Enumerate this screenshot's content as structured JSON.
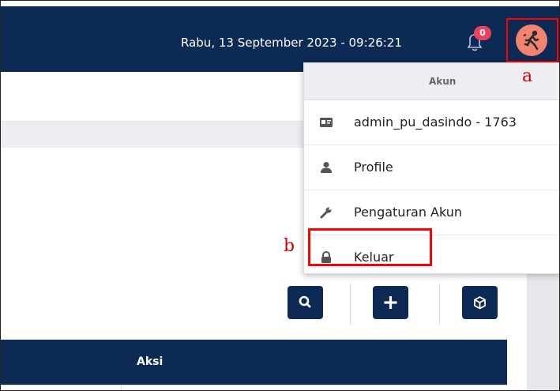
{
  "header": {
    "datetime": "Rabu, 13 September 2023 - 09:26:21",
    "notification_count": "0"
  },
  "account_menu": {
    "title": "Akun",
    "items": [
      {
        "label": "admin_pu_dasindo - 1763",
        "icon": "id-card-icon"
      },
      {
        "label": "Profile",
        "icon": "user-icon"
      },
      {
        "label": "Pengaturan Akun",
        "icon": "wrench-icon"
      },
      {
        "label": "Keluar",
        "icon": "lock-icon"
      }
    ]
  },
  "annotations": {
    "a": "a",
    "b": "b"
  },
  "toolbar": {
    "buttons": [
      "search-icon",
      "plus-icon",
      "box-icon"
    ]
  },
  "table": {
    "columns": [
      "Aksi"
    ]
  },
  "colors": {
    "navy": "#0d2a55",
    "annotation_red": "#ff0000",
    "badge": "#e9435a",
    "avatar_bg": "#f2836f"
  }
}
